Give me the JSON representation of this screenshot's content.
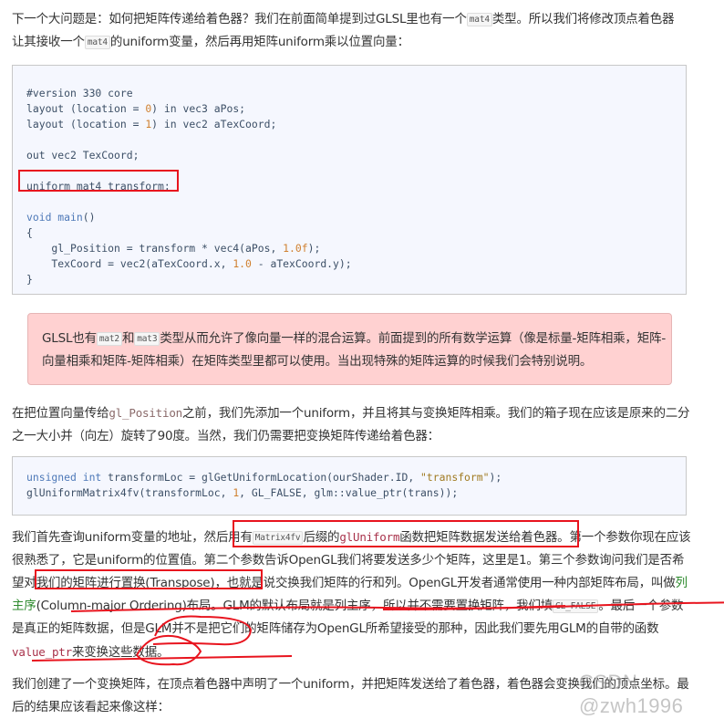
{
  "intro": {
    "line1_a": "下一个大问题是：如何把矩阵传递给着色器？我们在前面简单提到过GLSL里也有一个",
    "line1_code": "mat4",
    "line1_b": "类型。所以我们将修改顶点着色器",
    "line2_a": "让其接收一个",
    "line2_code": "mat4",
    "line2_b": "的uniform变量，然后再用矩阵uniform乘以位置向量："
  },
  "vertex_shader": {
    "lines": [
      "",
      "#version 330 core",
      "layout (location = 0) in vec3 aPos;",
      "layout (location = 1) in vec2 aTexCoord;",
      "",
      "out vec2 TexCoord;",
      "",
      "uniform mat4 transform;",
      "",
      "void main()",
      "{",
      "    gl_Position = transform * vec4(aPos, 1.0f);",
      "    TexCoord = vec2(aTexCoord.x, 1.0 - aTexCoord.y);",
      "}"
    ],
    "highlighted_line": "uniform mat4 transform;"
  },
  "note": {
    "a": "GLSL也有",
    "code1": "mat2",
    "b": "和",
    "code2": "mat3",
    "c": "类型从而允许了像向量一样的混合运算。前面提到的所有数学运算（像是标量-矩阵相乘，矩阵-向量相乘和矩阵-矩阵相乘）在矩阵类型里都可以使用。当出现特殊的矩阵运算的时候我们会特别说明。",
    "bg_color": "#ffd1d1"
  },
  "para2": {
    "a": "在把位置向量传给",
    "code": "gl_Position",
    "b": "之前，我们先添加一个uniform，并且将其与变换矩阵相乘。我们的箱子现在应该是原来的二分之一大小并（向左）旋转了90度。当然，我们仍需要把变换矩阵传递给着色器："
  },
  "cpp_code": {
    "line1_a": "unsigned int",
    "line1_b": " transformLoc = glGetUniformLocation(ourShader.ID, ",
    "line1_str": "\"transform\"",
    "line1_c": ");",
    "line2_a": "glUniformMatrix4fv(transformLoc, ",
    "line2_num": "1",
    "line2_b": ", GL_FALSE, glm::value_ptr(trans));"
  },
  "para3": {
    "a": "我们首先查询uniform变量的地址，然后用有",
    "code1": "Matrix4fv",
    "b": "后缀的",
    "code2": "glUniform",
    "c": "函数把矩阵数据发送给着色器。第一个参数你现在应该很熟悉了，它是uniform的位置值。第二个参数告诉OpenGL我们将要发送多少个矩阵，这里是1。第三个参数询问我们是否希望对我们的矩阵进行置换(Transpose)，也就是说交换我们矩阵的行和列。OpenGL开发者通常使用一种内部矩阵布局，叫做",
    "green": "列主序",
    "d": "(Column-major Ordering)布局。GLM的默认布局就是列主序，所以并不需要置换矩阵，我们填",
    "code3": "GL_FALSE",
    "e": "。最后一个参数是真正的矩阵数据，但是GLM并不是把它们的矩阵储存为OpenGL所希望接受的那种，因此我们要先用GLM的自带的函数",
    "code4": "value_ptr",
    "f": "来变换这些数据。"
  },
  "para4": {
    "text": "我们创建了一个变换矩阵，在顶点着色器中声明了一个uniform，并把矩阵发送给了着色器，着色器会变换我们的顶点坐标。最后的结果应该看起来像这样："
  },
  "watermark": "CSDN @zwh1996",
  "annotation_color": "#e8141e"
}
